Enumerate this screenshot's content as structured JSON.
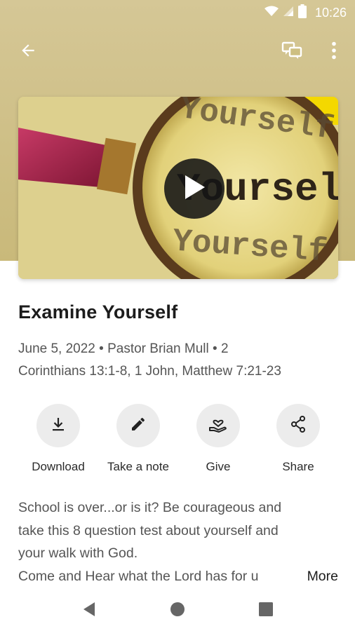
{
  "status_bar": {
    "time": "10:26"
  },
  "app_bar": {
    "back_icon": "arrow-back-icon",
    "notes_icon": "notes-icon",
    "menu_icon": "more-vert-icon"
  },
  "video": {
    "thumbnail_words": [
      "Yourself",
      "Yourself",
      "Yourself"
    ],
    "play_icon": "play-icon"
  },
  "sermon": {
    "title": "Examine Yourself",
    "meta_line1": "June 5, 2022 • Pastor Brian Mull • 2",
    "meta_line2": "Corinthians 13:1-8, 1 John, Matthew 7:21-23"
  },
  "actions": [
    {
      "label": "Download",
      "icon": "download-icon"
    },
    {
      "label": "Take a note",
      "icon": "pencil-icon"
    },
    {
      "label": "Give",
      "icon": "give-hand-heart-icon"
    },
    {
      "label": "Share",
      "icon": "share-icon"
    }
  ],
  "description": {
    "line1": "School is over...or is it? Be courageous and",
    "line2": "take this 8 question test about yourself and",
    "line3": "your walk with God.",
    "line4": "Come and Hear what the Lord has for u",
    "more_label": "More"
  },
  "colors": {
    "header": "#cfc084",
    "title_text": "#1c1c1c",
    "body_text": "#555555",
    "action_circle": "#ececec"
  }
}
